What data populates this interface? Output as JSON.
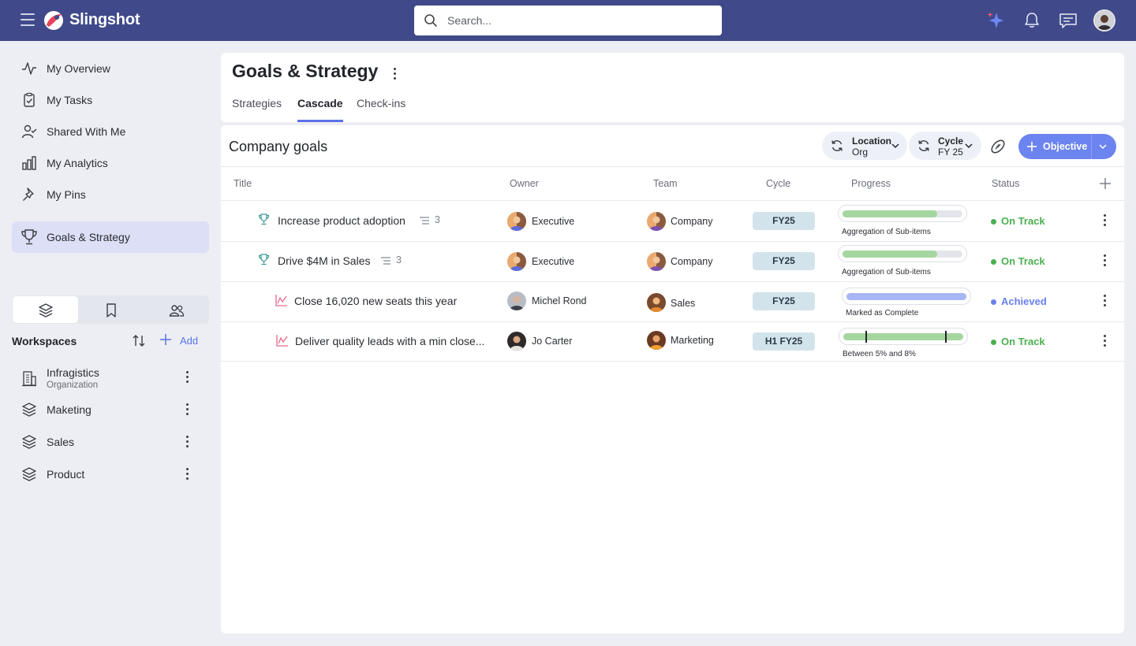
{
  "app": {
    "name": "Slingshot"
  },
  "search": {
    "placeholder": "Search..."
  },
  "top_icons": [
    "sparkle-ai-icon",
    "bell-icon",
    "chat-icon",
    "user-avatar"
  ],
  "sidebar": {
    "items": [
      {
        "label": "My Overview",
        "icon": "activity-icon"
      },
      {
        "label": "My Tasks",
        "icon": "clipboard-check-icon"
      },
      {
        "label": "Shared With Me",
        "icon": "user-check-icon"
      },
      {
        "label": "My Analytics",
        "icon": "bar-chart-icon"
      },
      {
        "label": "My Pins",
        "icon": "pin-icon"
      },
      {
        "label": "Goals & Strategy",
        "icon": "trophy-icon",
        "active": true
      }
    ],
    "workspace_tabs": [
      "layers-icon",
      "bookmark-icon",
      "users-icon"
    ],
    "workspaces_title": "Workspaces",
    "add_label": "Add",
    "workspaces": [
      {
        "label": "Infragistics",
        "sub": "Organization",
        "icon": "building-icon"
      },
      {
        "label": "Maketing",
        "icon": "layers-icon"
      },
      {
        "label": "Sales",
        "icon": "layers-icon"
      },
      {
        "label": "Product",
        "icon": "layers-icon"
      }
    ]
  },
  "header": {
    "title": "Goals & Strategy",
    "tabs": [
      {
        "label": "Strategies"
      },
      {
        "label": "Cascade",
        "active": true
      },
      {
        "label": "Check-ins"
      }
    ]
  },
  "main": {
    "section_title": "Company goals",
    "filters": [
      {
        "key": "Location",
        "value": "Org"
      },
      {
        "key": "Cycle",
        "value": "FY 25"
      }
    ],
    "objective_button": "Objective",
    "columns": [
      "Title",
      "Owner",
      "Team",
      "Cycle",
      "Progress",
      "Status"
    ],
    "rows": [
      {
        "title": "Increase product adoption",
        "type_icon": "trophy-icon",
        "sub_count": "3",
        "owner": "Executive",
        "team": "Company",
        "cycle": "FY25",
        "progress": 0.8,
        "progress_caption": "Aggregation of Sub-items",
        "status": "On Track"
      },
      {
        "title": "Drive $4M in Sales",
        "type_icon": "trophy-icon",
        "sub_count": "3",
        "owner": "Executive",
        "team": "Company",
        "cycle": "FY25",
        "progress": 0.8,
        "progress_caption": "Aggregation of Sub-items",
        "status": "On Track"
      },
      {
        "title": "Close 16,020 new seats this year",
        "type_icon": "kpi-chart-icon",
        "owner": "Michel Rond",
        "team": "Sales",
        "cycle": "FY25",
        "progress": 1.0,
        "progress_caption": "Marked as Complete",
        "status": "Achieved"
      },
      {
        "title": "Deliver quality leads with a min close...",
        "type_icon": "kpi-chart-icon",
        "owner": "Jo Carter",
        "team": "Marketing",
        "cycle": "H1 FY25",
        "progress": 1.0,
        "progress_caption": "Between 5% and 8%",
        "status": "On Track"
      }
    ]
  },
  "colors": {
    "topbar": "#404a8a",
    "accent": "#5b72e8",
    "on_track": "#4caf50",
    "achieved": "#6a80ee",
    "progress_green": "#a5d6a0",
    "progress_blue": "#a9b6f5"
  }
}
